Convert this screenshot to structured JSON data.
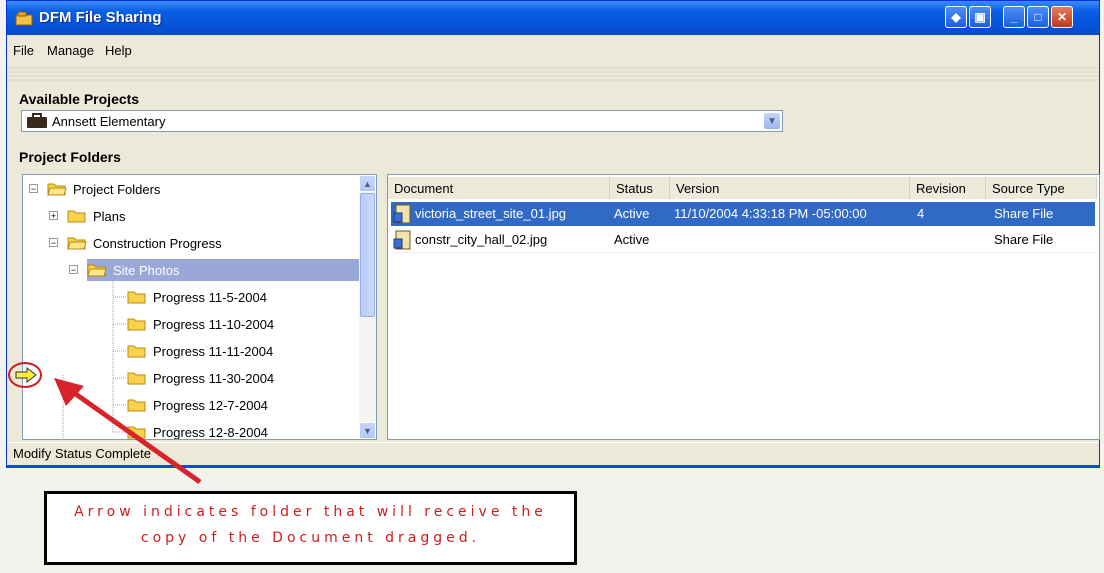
{
  "window": {
    "title": "DFM File Sharing",
    "controls": [
      "restore-alt",
      "sidebar",
      "minimize",
      "maximize",
      "close"
    ]
  },
  "menu": [
    "File",
    "Manage",
    "Help"
  ],
  "projects": {
    "label": "Available Projects",
    "selected": "Annsett Elementary"
  },
  "folders": {
    "label": "Project Folders",
    "tree": [
      {
        "label": "Project Folders",
        "expander": "−"
      },
      {
        "label": "Plans",
        "expander": "+"
      },
      {
        "label": "Construction Progress",
        "expander": "−"
      },
      {
        "label": "Site Photos",
        "expander": "−"
      },
      {
        "label": "Progress 11-5-2004"
      },
      {
        "label": "Progress 11-10-2004"
      },
      {
        "label": "Progress 11-11-2004"
      },
      {
        "label": "Progress 11-30-2004"
      },
      {
        "label": "Progress 12-7-2004"
      },
      {
        "label": "Progress 12-8-2004"
      }
    ]
  },
  "documents": {
    "columns": [
      "Document",
      "Status",
      "Version",
      "Revision",
      "Source Type"
    ],
    "rows": [
      {
        "document": "victoria_street_site_01.jpg",
        "status": "Active",
        "version": "11/10/2004 4:33:18 PM -05:00:00",
        "revision": "4",
        "source": "Share File"
      },
      {
        "document": "constr_city_hall_02.jpg",
        "status": "Active",
        "version": "",
        "revision": "",
        "source": "Share File"
      }
    ]
  },
  "status": "Modify Status Complete",
  "callout": {
    "line1": "Arrow indicates folder that will receive the",
    "line2": "copy of the Document dragged."
  },
  "colors": {
    "title_bar": "#0553d8",
    "selection": "#316ac5",
    "annotation": "#d01c1c"
  }
}
